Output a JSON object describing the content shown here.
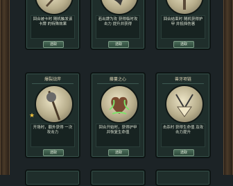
{
  "cards": [
    {
      "icon": "sword-icon",
      "desc": "回合被卡时 随机触发该卡牌 的特殊效果",
      "button": "选取",
      "star": false
    },
    {
      "icon": "raven-icon",
      "desc": "若出牌为攻 获得临时攻击力 提升并获得",
      "button": "选取",
      "star": false
    },
    {
      "icon": "hammer-icon",
      "desc": "回合结束时 随机获得护甲 并抵挡伤害",
      "button": "选取",
      "star": false
    },
    {
      "caption": "爆裂战斧",
      "icon": "staff-icon",
      "desc": "开场时，额外获得 一次攻击力",
      "button": "选取",
      "star": true
    },
    {
      "caption": "藤蔓之心",
      "icon": "heart-icon",
      "desc": "回合开始时，获得护甲 并恢复生命值",
      "button": "选取",
      "star": false
    },
    {
      "caption": "兽牙项链",
      "icon": "bone-icon",
      "desc": "击杀时 获得生命值 及攻击力提升",
      "button": "选取",
      "star": false
    }
  ],
  "colors": {
    "accent": "#f2c33c",
    "card_bg": "#1f2e2b",
    "vine": "#7ee16a"
  }
}
